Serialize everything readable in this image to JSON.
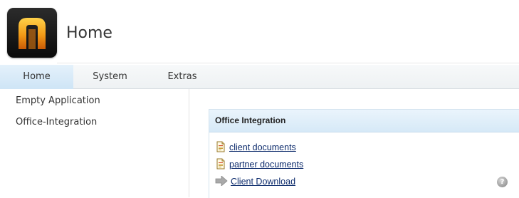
{
  "header": {
    "title": "Home",
    "logo_icon": "app-logo-icon"
  },
  "tabs": [
    {
      "label": "Home",
      "active": true
    },
    {
      "label": "System",
      "active": false
    },
    {
      "label": "Extras",
      "active": false
    }
  ],
  "sidebar": {
    "items": [
      {
        "label": "Empty Application"
      },
      {
        "label": "Office-Integration"
      }
    ]
  },
  "panel": {
    "title": "Office Integration",
    "links": [
      {
        "label": "client documents",
        "icon": "document-icon"
      },
      {
        "label": "partner documents",
        "icon": "document-icon"
      },
      {
        "label": "Client Download",
        "icon": "arrow-right-icon"
      }
    ],
    "help_icon": "help-icon"
  },
  "colors": {
    "active_tab": "#cfe5f6",
    "panel_header": "#d6e9f7",
    "link": "#0b2a6b",
    "logo_accent": "#f3a21b"
  }
}
